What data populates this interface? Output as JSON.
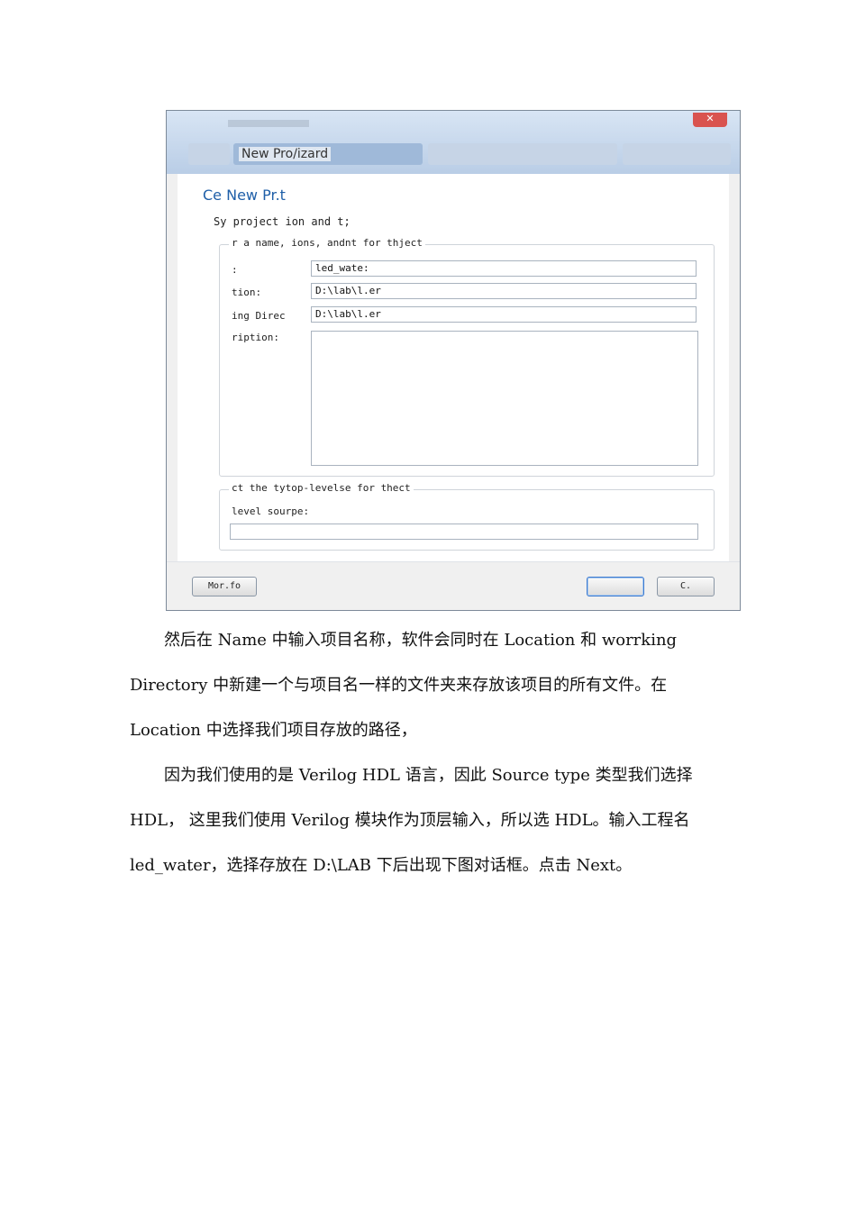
{
  "dialog": {
    "close_glyph": "✕",
    "breadcrumb": "New Pro/izard",
    "heading": "Ce New Pr.t",
    "subtitle": "Sy project ion and t;",
    "group1_legend": "r a name, ions, andnt for thject",
    "name_label": ":",
    "name_value": "led_wate:",
    "location_label": "tion:",
    "location_value": "D:\\lab\\l.er",
    "working_dir_label": "ing Direc",
    "working_dir_value": "D:\\lab\\l.er",
    "description_label": "ription:",
    "group2_legend": "ct the tytop-levelse for thect",
    "top_level_label": "level sourpe:",
    "more_button": "Mor.fo",
    "ok_button": "",
    "cancel_button": "C."
  },
  "body": {
    "line1": "然后在  Name  中输入项目名称，软件会同时在 Location  和  worrking",
    "line2": "Directory  中新建一个与项目名一样的文件夹来存放该项目的所有文件。在",
    "line3": "Location  中选择我们项目存放的路径，",
    "line4": "因为我们使用的是  Verilog  HDL  语言，因此 Source type   类型我们选择",
    "line5": "HDL，  这里我们使用  Verilog  模块作为顶层输入，所以选 HDL。输入工程名",
    "line6": "led_water，选择存放在  D:\\LAB  下后出现下图对话框。点击 Next。"
  }
}
